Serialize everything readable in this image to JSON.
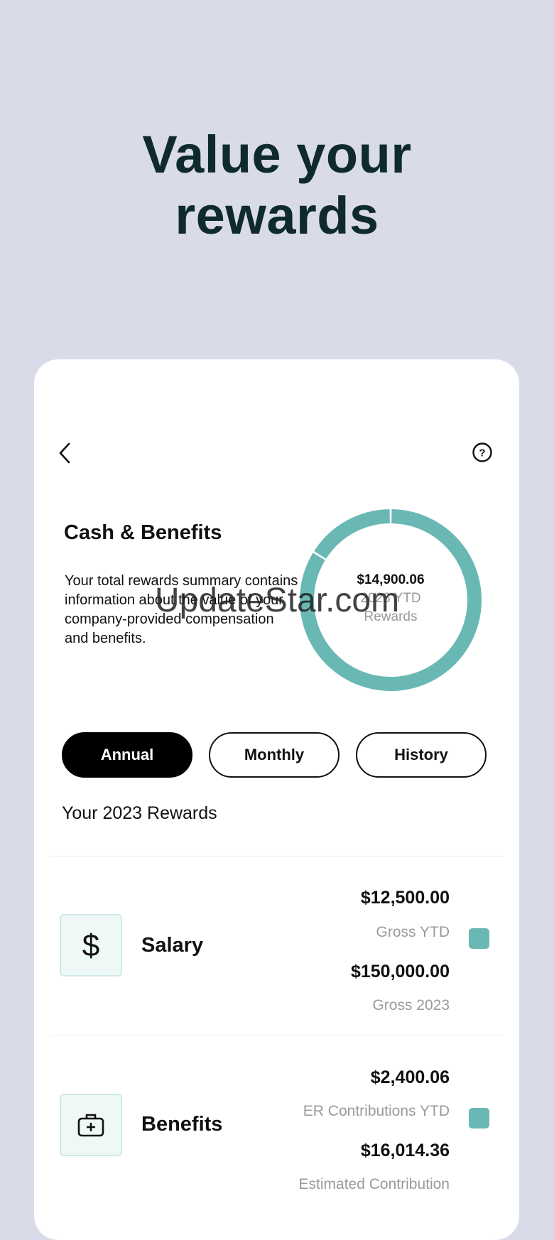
{
  "headline": [
    "Value your",
    "rewards"
  ],
  "icons": {
    "back": "chevron-left-icon",
    "help": "question-circle-icon",
    "salary": "dollar-icon",
    "benefits": "medical-kit-icon"
  },
  "summary": {
    "title": "Cash & Benefits",
    "description": "Your total rewards summary contains information about the value of your company-provided compensation and benefits.",
    "total_amount": "$14,900.06",
    "total_label": "2023 YTD",
    "total_label2": "Rewards"
  },
  "chart_data": {
    "type": "pie",
    "style": "donut",
    "slices": [
      {
        "name": "Salary",
        "value": 12500.0,
        "color": "#6ab8b4"
      },
      {
        "name": "Benefits",
        "value": 2400.06,
        "color": "#6ab8b4"
      }
    ],
    "center_text": [
      "$14,900.06",
      "2023 YTD",
      "Rewards"
    ]
  },
  "watermark": "UpdateStar.com",
  "tabs": [
    {
      "label": "Annual",
      "active": true
    },
    {
      "label": "Monthly",
      "active": false
    },
    {
      "label": "History",
      "active": false
    }
  ],
  "rewards_title": "Your 2023 Rewards",
  "rows": [
    {
      "label": "Salary",
      "amount1": "$12,500.00",
      "sub1": "Gross YTD",
      "amount2": "$150,000.00",
      "sub2": "Gross 2023",
      "color": "#6ab8b4"
    },
    {
      "label": "Benefits",
      "amount1": "$2,400.06",
      "sub1": "ER Contributions YTD",
      "amount2": "$16,014.36",
      "sub2": "Estimated Contribution",
      "color": "#6ab8b4"
    }
  ],
  "colors": {
    "accent": "#6ab8b4",
    "background": "#d9dbe8",
    "headline": "#0f2a2a"
  }
}
